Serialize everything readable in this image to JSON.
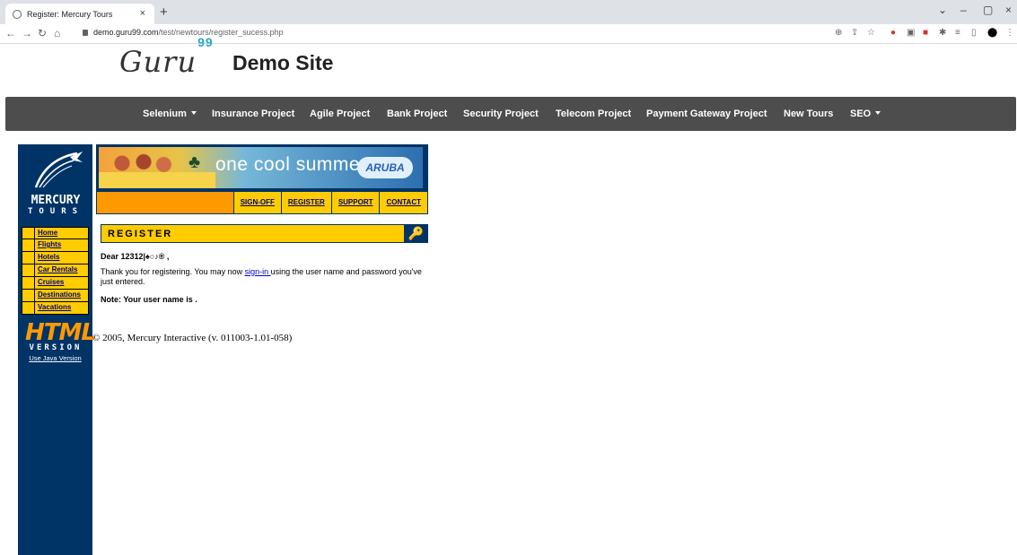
{
  "browser": {
    "tab_title": "Register: Mercury Tours",
    "tab_close": "×",
    "new_tab": "+",
    "url_host": "demo.guru99.com",
    "url_path": "/test/newtours/register_sucess.php",
    "window_controls": [
      "⌄",
      "–",
      "▢",
      "×"
    ]
  },
  "site": {
    "logo": "Guru",
    "logo_sup": "99",
    "title": "Demo Site"
  },
  "nav": {
    "items": [
      {
        "label": "Selenium",
        "caret": true
      },
      {
        "label": "Insurance Project"
      },
      {
        "label": "Agile Project"
      },
      {
        "label": "Bank Project"
      },
      {
        "label": "Security Project"
      },
      {
        "label": "Telecom Project"
      },
      {
        "label": "Payment Gateway Project"
      },
      {
        "label": "New Tours"
      },
      {
        "label": "SEO",
        "caret": true
      }
    ]
  },
  "sidebar": {
    "brand_line1": "MERCURY",
    "brand_line2": "TOURS",
    "menu": [
      "Home",
      "Flights",
      "Hotels",
      "Car Rentals",
      "Cruises",
      "Destinations",
      "Vacations"
    ],
    "html_logo": "HTML",
    "version_label": "VERSION",
    "java_link": "Use Java Version"
  },
  "banner": {
    "text": "one cool summer",
    "brand": "ARUBA"
  },
  "toplinks": [
    "SIGN-OFF",
    "REGISTER",
    "SUPPORT",
    "CONTACT"
  ],
  "register": {
    "heading": "REGISTER",
    "dear": "Dear 12312|♠○♪®  ,",
    "thanks_before": "Thank you for registering. You may now ",
    "sign_in": "sign-in ",
    "thanks_after": "using the user name and password you've just entered.",
    "note": "Note: Your user name is ."
  },
  "footer": {
    "copyright": "© 2005, Mercury Interactive (v. 011003-1.01-058)"
  },
  "colors": {
    "navbar": "#4d4d4d",
    "sidebar": "#003366",
    "menu_yellow": "#ffcc00",
    "orange": "#ff9900"
  }
}
